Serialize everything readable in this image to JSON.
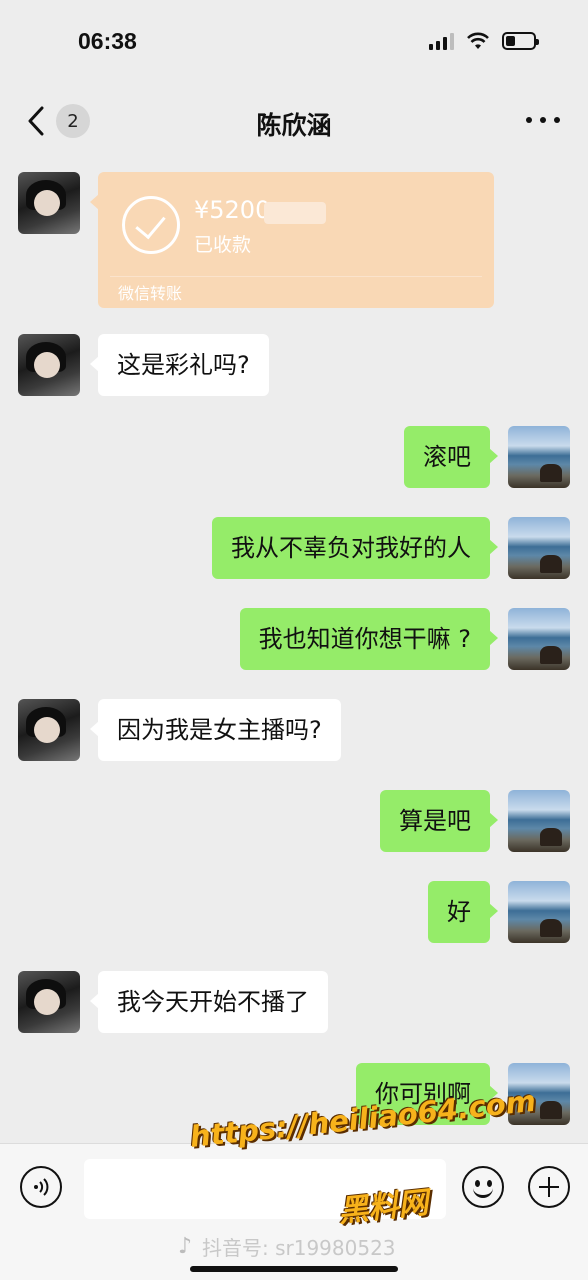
{
  "status_bar": {
    "time": "06:38"
  },
  "header": {
    "back_badge": "2",
    "title": "陈欣涵"
  },
  "transfer": {
    "amount": "¥5200",
    "status": "已收款",
    "label": "微信转账"
  },
  "messages": [
    {
      "side": "in",
      "text": "这是彩礼吗?"
    },
    {
      "side": "out",
      "text": "滚吧"
    },
    {
      "side": "out",
      "text": "我从不辜负对我好的人"
    },
    {
      "side": "out",
      "text": "我也知道你想干嘛 ?"
    },
    {
      "side": "in",
      "text": "因为我是女主播吗?"
    },
    {
      "side": "out",
      "text": "算是吧"
    },
    {
      "side": "out",
      "text": "好"
    },
    {
      "side": "in",
      "text": "我今天开始不播了"
    },
    {
      "side": "out",
      "text": "你可别啊"
    }
  ],
  "watermark": {
    "url": "https://heiliao64.com",
    "site": "黑料网",
    "douyin": "抖音号: sr19980523"
  },
  "icons": [
    "back-arrow-icon",
    "more-icon",
    "check-circle-icon",
    "voice-icon",
    "emoji-icon",
    "plus-icon",
    "signal-icon",
    "wifi-icon",
    "battery-icon"
  ]
}
